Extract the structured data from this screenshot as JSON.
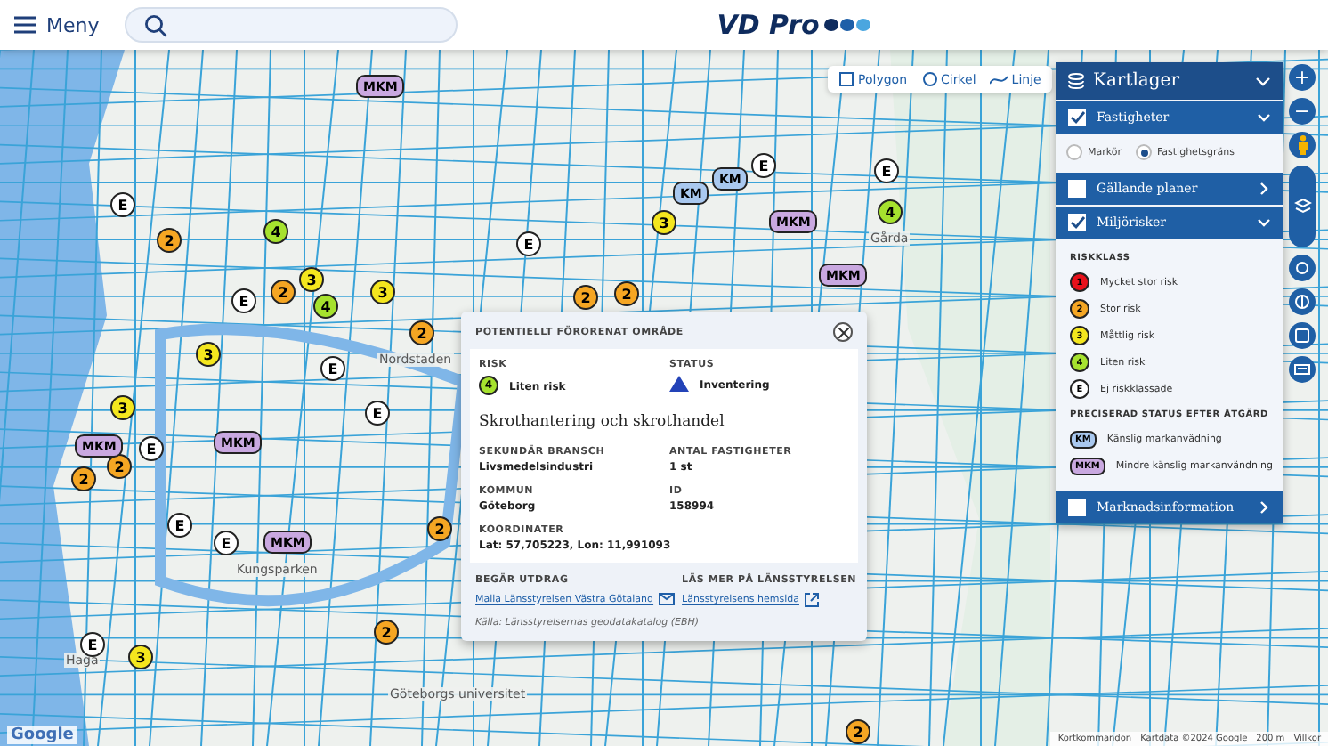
{
  "header": {
    "menu_label": "Meny",
    "logo": "VD Pro"
  },
  "draw_tools": [
    {
      "label": "Polygon",
      "kind": "polygon"
    },
    {
      "label": "Cirkel",
      "kind": "circle"
    },
    {
      "label": "Linje",
      "kind": "line"
    }
  ],
  "markers": [
    {
      "kind": "risk",
      "label": "2",
      "color": "#f5a623"
    },
    {
      "kind": "risk",
      "label": "E",
      "color": "#ffffff"
    },
    {
      "kind": "risk",
      "label": "4",
      "color": "#a6e22e"
    },
    {
      "kind": "risk",
      "label": "3",
      "color": "#f4e61e"
    },
    {
      "kind": "risk",
      "label": "2",
      "color": "#f5a623"
    },
    {
      "kind": "risk",
      "label": "E",
      "color": "#ffffff"
    },
    {
      "kind": "risk",
      "label": "3",
      "color": "#f4e61e"
    },
    {
      "kind": "risk",
      "label": "E",
      "color": "#ffffff"
    },
    {
      "kind": "risk",
      "label": "2",
      "color": "#f5a623"
    },
    {
      "kind": "risk",
      "label": "4",
      "color": "#a6e22e"
    },
    {
      "kind": "risk",
      "label": "E",
      "color": "#ffffff"
    },
    {
      "kind": "risk",
      "label": "3",
      "color": "#f4e61e"
    },
    {
      "kind": "risk",
      "label": "2",
      "color": "#f5a623"
    },
    {
      "kind": "risk",
      "label": "E",
      "color": "#ffffff"
    },
    {
      "kind": "risk",
      "label": "3",
      "color": "#f4e61e"
    },
    {
      "kind": "risk",
      "label": "2",
      "color": "#f5a623"
    },
    {
      "kind": "risk",
      "label": "E",
      "color": "#ffffff"
    },
    {
      "kind": "risk",
      "label": "E",
      "color": "#ffffff"
    },
    {
      "kind": "risk",
      "label": "2",
      "color": "#f5a623"
    },
    {
      "kind": "risk",
      "label": "3",
      "color": "#f4e61e"
    },
    {
      "kind": "risk",
      "label": "E",
      "color": "#ffffff"
    },
    {
      "kind": "risk",
      "label": "2",
      "color": "#f5a623"
    },
    {
      "kind": "risk",
      "label": "E",
      "color": "#ffffff"
    },
    {
      "kind": "risk",
      "label": "2",
      "color": "#f5a623"
    },
    {
      "kind": "risk",
      "label": "4",
      "color": "#a6e22e"
    },
    {
      "kind": "risk",
      "label": "E",
      "color": "#ffffff"
    },
    {
      "kind": "risk",
      "label": "3",
      "color": "#f4e61e"
    },
    {
      "kind": "risk",
      "label": "2",
      "color": "#f5a623"
    },
    {
      "kind": "risk",
      "label": "E",
      "color": "#ffffff"
    },
    {
      "kind": "risk",
      "label": "2",
      "color": "#f5a623"
    },
    {
      "kind": "status",
      "label": "MKM",
      "color": "#c9a8e0"
    },
    {
      "kind": "status",
      "label": "MKM",
      "color": "#c9a8e0"
    },
    {
      "kind": "status",
      "label": "KM",
      "color": "#a9c8ef"
    },
    {
      "kind": "status",
      "label": "KM",
      "color": "#a9c8ef"
    },
    {
      "kind": "status",
      "label": "MKM",
      "color": "#c9a8e0"
    },
    {
      "kind": "status",
      "label": "MKM",
      "color": "#c9a8e0"
    },
    {
      "kind": "status",
      "label": "MKM",
      "color": "#c9a8e0"
    },
    {
      "kind": "status",
      "label": "MKM",
      "color": "#c9a8e0"
    }
  ],
  "map_labels": [
    "Nordstaden",
    "Kungsparken",
    "Haga",
    "Göteborgs universitet",
    "Gårda"
  ],
  "popup": {
    "title": "POTENTIELLT FÖRORENAT OMRÅDE",
    "risk_label": "RISK",
    "risk": {
      "label": "4",
      "color": "#a6e22e",
      "text": "Liten risk"
    },
    "status_label": "STATUS",
    "status_text": "Inventering",
    "name": "Skrothantering och skrothandel",
    "fields": [
      {
        "label": "SEKUNDÄR BRANSCH",
        "value": "Livsmedelsindustri"
      },
      {
        "label": "ANTAL FASTIGHETER",
        "value": "1 st"
      },
      {
        "label": "KOMMUN",
        "value": "Göteborg"
      },
      {
        "label": "ID",
        "value": "158994"
      },
      {
        "label": "KOORDINATER",
        "value": "Lat: 57,705223, Lon: 11,991093"
      }
    ],
    "order_label": "BEGÄR UTDRAG",
    "order_link": "Maila Länsstyrelsen Västra Götaland",
    "more_label": "LÄS MER PÅ LÄNSSTYRELSEN",
    "more_link": "Länsstyrelsens hemsida",
    "source": "Källa: Länsstyrelsernas geodatakatalog (EBH)"
  },
  "layers": {
    "title": "Kartlager",
    "expanded": true,
    "groups": [
      {
        "label": "Fastigheter",
        "checked": true,
        "expanded": true,
        "kind": "radio",
        "options": [
          {
            "label": "Markör",
            "selected": false
          },
          {
            "label": "Fastighetsgräns",
            "selected": true
          }
        ]
      },
      {
        "label": "Gällande planer",
        "checked": false,
        "expanded": false
      },
      {
        "label": "Miljörisker",
        "checked": true,
        "expanded": true,
        "kind": "legend",
        "sections": [
          {
            "title": "RISKKLASS",
            "items": [
              {
                "badge": "1",
                "color": "#e8101a",
                "text": "Mycket stor risk"
              },
              {
                "badge": "2",
                "color": "#f5a623",
                "text": "Stor risk"
              },
              {
                "badge": "3",
                "color": "#f4e61e",
                "text": "Måttlig risk"
              },
              {
                "badge": "4",
                "color": "#a6e22e",
                "text": "Liten risk"
              },
              {
                "badge": "E",
                "color": "#ffffff",
                "text": "Ej riskklassade"
              }
            ]
          },
          {
            "title": "PRECISERAD STATUS EFTER ÅTGÄRD",
            "items": [
              {
                "badge": "KM",
                "color": "#a9c8ef",
                "text": "Känslig markanvädning"
              },
              {
                "badge": "MKM",
                "color": "#c9a8e0",
                "text": "Mindre känslig markanvändning"
              }
            ]
          }
        ]
      },
      {
        "label": "Marknadsinformation",
        "checked": false,
        "expanded": false
      }
    ]
  },
  "map_controls": [
    "+",
    "−"
  ],
  "google_logo": "Google",
  "footer": [
    "Kortkommandon",
    "Kartdata ©2024 Google",
    "200 m",
    "Villkor"
  ]
}
